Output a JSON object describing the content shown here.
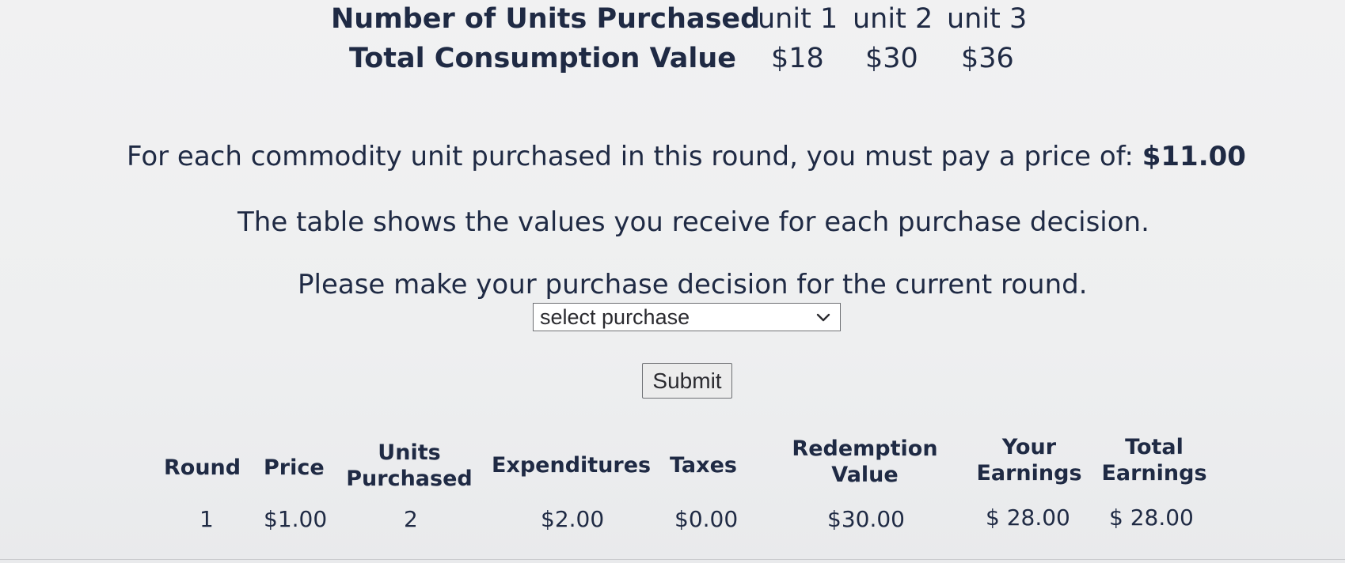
{
  "value_table": {
    "row_units_label": "Number of Units Purchased",
    "row_value_label": "Total Consumption Value",
    "units": [
      "unit 1",
      "unit 2",
      "unit 3"
    ],
    "values": [
      "$18",
      "$30",
      "$36"
    ]
  },
  "instructions": {
    "price_text": "For each commodity unit purchased in this round, you must pay a price of:",
    "price_value": "$11.00",
    "table_text": "The table shows the values you receive for each purchase decision.",
    "decision_text": "Please make your purchase decision for the current round."
  },
  "purchase_select": {
    "selected": "select purchase"
  },
  "submit_button": {
    "label": "Submit"
  },
  "history_table": {
    "headers": {
      "round": "Round",
      "price": "Price",
      "units_line1": "Units",
      "units_line2": "Purchased",
      "expenditures": "Expenditures",
      "taxes": "Taxes",
      "redemption_line1": "Redemption",
      "redemption_line2": "Value",
      "your_line1": "Your",
      "your_line2": "Earnings",
      "total_line1": "Total",
      "total_line2": "Earnings"
    },
    "rows": [
      {
        "round": "1",
        "price": "$1.00",
        "units": "2",
        "expenditures": "$2.00",
        "taxes": "$0.00",
        "redemption": "$30.00",
        "your_earnings": "$ 28.00",
        "total_earnings": "$ 28.00"
      }
    ]
  }
}
